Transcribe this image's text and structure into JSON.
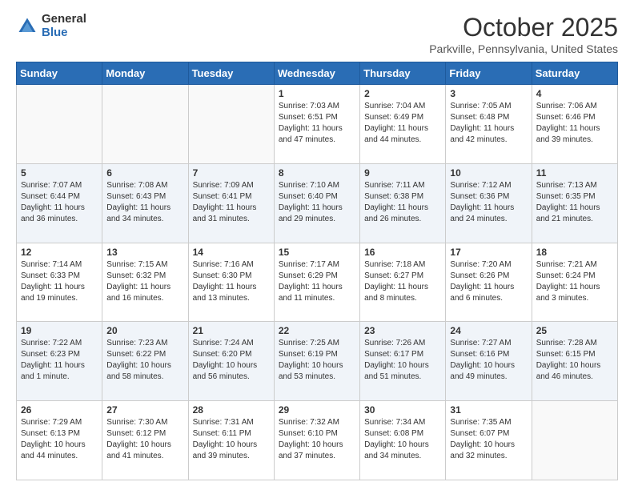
{
  "logo": {
    "general": "General",
    "blue": "Blue"
  },
  "title": "October 2025",
  "location": "Parkville, Pennsylvania, United States",
  "days_of_week": [
    "Sunday",
    "Monday",
    "Tuesday",
    "Wednesday",
    "Thursday",
    "Friday",
    "Saturday"
  ],
  "weeks": [
    [
      {
        "day": "",
        "info": ""
      },
      {
        "day": "",
        "info": ""
      },
      {
        "day": "",
        "info": ""
      },
      {
        "day": "1",
        "info": "Sunrise: 7:03 AM\nSunset: 6:51 PM\nDaylight: 11 hours and 47 minutes."
      },
      {
        "day": "2",
        "info": "Sunrise: 7:04 AM\nSunset: 6:49 PM\nDaylight: 11 hours and 44 minutes."
      },
      {
        "day": "3",
        "info": "Sunrise: 7:05 AM\nSunset: 6:48 PM\nDaylight: 11 hours and 42 minutes."
      },
      {
        "day": "4",
        "info": "Sunrise: 7:06 AM\nSunset: 6:46 PM\nDaylight: 11 hours and 39 minutes."
      }
    ],
    [
      {
        "day": "5",
        "info": "Sunrise: 7:07 AM\nSunset: 6:44 PM\nDaylight: 11 hours and 36 minutes."
      },
      {
        "day": "6",
        "info": "Sunrise: 7:08 AM\nSunset: 6:43 PM\nDaylight: 11 hours and 34 minutes."
      },
      {
        "day": "7",
        "info": "Sunrise: 7:09 AM\nSunset: 6:41 PM\nDaylight: 11 hours and 31 minutes."
      },
      {
        "day": "8",
        "info": "Sunrise: 7:10 AM\nSunset: 6:40 PM\nDaylight: 11 hours and 29 minutes."
      },
      {
        "day": "9",
        "info": "Sunrise: 7:11 AM\nSunset: 6:38 PM\nDaylight: 11 hours and 26 minutes."
      },
      {
        "day": "10",
        "info": "Sunrise: 7:12 AM\nSunset: 6:36 PM\nDaylight: 11 hours and 24 minutes."
      },
      {
        "day": "11",
        "info": "Sunrise: 7:13 AM\nSunset: 6:35 PM\nDaylight: 11 hours and 21 minutes."
      }
    ],
    [
      {
        "day": "12",
        "info": "Sunrise: 7:14 AM\nSunset: 6:33 PM\nDaylight: 11 hours and 19 minutes."
      },
      {
        "day": "13",
        "info": "Sunrise: 7:15 AM\nSunset: 6:32 PM\nDaylight: 11 hours and 16 minutes."
      },
      {
        "day": "14",
        "info": "Sunrise: 7:16 AM\nSunset: 6:30 PM\nDaylight: 11 hours and 13 minutes."
      },
      {
        "day": "15",
        "info": "Sunrise: 7:17 AM\nSunset: 6:29 PM\nDaylight: 11 hours and 11 minutes."
      },
      {
        "day": "16",
        "info": "Sunrise: 7:18 AM\nSunset: 6:27 PM\nDaylight: 11 hours and 8 minutes."
      },
      {
        "day": "17",
        "info": "Sunrise: 7:20 AM\nSunset: 6:26 PM\nDaylight: 11 hours and 6 minutes."
      },
      {
        "day": "18",
        "info": "Sunrise: 7:21 AM\nSunset: 6:24 PM\nDaylight: 11 hours and 3 minutes."
      }
    ],
    [
      {
        "day": "19",
        "info": "Sunrise: 7:22 AM\nSunset: 6:23 PM\nDaylight: 11 hours and 1 minute."
      },
      {
        "day": "20",
        "info": "Sunrise: 7:23 AM\nSunset: 6:22 PM\nDaylight: 10 hours and 58 minutes."
      },
      {
        "day": "21",
        "info": "Sunrise: 7:24 AM\nSunset: 6:20 PM\nDaylight: 10 hours and 56 minutes."
      },
      {
        "day": "22",
        "info": "Sunrise: 7:25 AM\nSunset: 6:19 PM\nDaylight: 10 hours and 53 minutes."
      },
      {
        "day": "23",
        "info": "Sunrise: 7:26 AM\nSunset: 6:17 PM\nDaylight: 10 hours and 51 minutes."
      },
      {
        "day": "24",
        "info": "Sunrise: 7:27 AM\nSunset: 6:16 PM\nDaylight: 10 hours and 49 minutes."
      },
      {
        "day": "25",
        "info": "Sunrise: 7:28 AM\nSunset: 6:15 PM\nDaylight: 10 hours and 46 minutes."
      }
    ],
    [
      {
        "day": "26",
        "info": "Sunrise: 7:29 AM\nSunset: 6:13 PM\nDaylight: 10 hours and 44 minutes."
      },
      {
        "day": "27",
        "info": "Sunrise: 7:30 AM\nSunset: 6:12 PM\nDaylight: 10 hours and 41 minutes."
      },
      {
        "day": "28",
        "info": "Sunrise: 7:31 AM\nSunset: 6:11 PM\nDaylight: 10 hours and 39 minutes."
      },
      {
        "day": "29",
        "info": "Sunrise: 7:32 AM\nSunset: 6:10 PM\nDaylight: 10 hours and 37 minutes."
      },
      {
        "day": "30",
        "info": "Sunrise: 7:34 AM\nSunset: 6:08 PM\nDaylight: 10 hours and 34 minutes."
      },
      {
        "day": "31",
        "info": "Sunrise: 7:35 AM\nSunset: 6:07 PM\nDaylight: 10 hours and 32 minutes."
      },
      {
        "day": "",
        "info": ""
      }
    ]
  ]
}
